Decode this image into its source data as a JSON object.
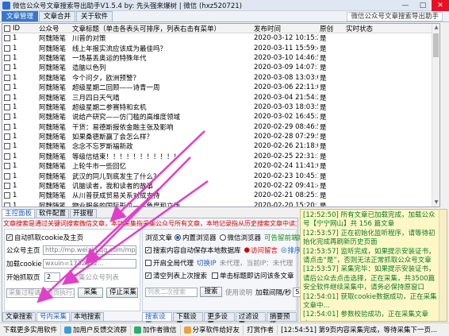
{
  "window": {
    "title": "微信公众号文章搜索导出助手V1.5.4   by:  先头强来爆树 | 微信   (hxz520721)",
    "controls": [
      "—",
      "□",
      "✕"
    ]
  },
  "top_tabs": [
    "文章管理",
    "文章合并",
    "关于软件"
  ],
  "top_right_text": "微信公众号文章搜索导出助手",
  "table": {
    "headers": [
      "ID",
      "公众号",
      "文章标题（单击各表头可排序，列表右击有菜单）",
      "发布时间",
      "原创",
      "实时状态"
    ],
    "rows": [
      {
        "id": "1",
        "account": "阿魏随笔",
        "title": "川普的对策",
        "time": "2020-03-12 10:15:24",
        "original": "是",
        "status": ""
      },
      {
        "id": "1",
        "account": "阿魏随笔",
        "title": "线上年报实流应该成为最佳吗？",
        "time": "2020-03-11 15:59:47",
        "original": "是",
        "status": ""
      },
      {
        "id": "1",
        "account": "阿魏随笔",
        "title": "一场基丢奥运的特殊年代",
        "time": "2020-03-10 14:46:52",
        "original": "是",
        "status": ""
      },
      {
        "id": "1",
        "account": "阿魏随笔",
        "title": "造脑以色列",
        "time": "2020-03-09 14:07:18",
        "original": "是",
        "status": ""
      },
      {
        "id": "1",
        "account": "阿魏随笔",
        "title": "今个问夕，欧洲预警？",
        "time": "2020-03-08 13:03:01",
        "original": "是",
        "status": ""
      },
      {
        "id": "1",
        "account": "阿魏随笔",
        "title": "超级星期二回顾——诗青一周",
        "time": "2020-03-06 22:11:07",
        "original": "是",
        "status": ""
      },
      {
        "id": "1",
        "account": "阿魏随笔",
        "title": "三月四日天气晴",
        "time": "2020-03-04 21:54:26",
        "original": "是",
        "status": ""
      },
      {
        "id": "1",
        "account": "阿魏随笔",
        "title": "超级星期二参赛特和玄机",
        "time": "2020-03-03 18:03:52",
        "original": "是",
        "status": ""
      },
      {
        "id": "1",
        "account": "阿魏随笔",
        "title": "说给产研究——仿门槛的高维度领域",
        "time": "2020-03-02 16:45:25",
        "original": "是",
        "status": ""
      },
      {
        "id": "1",
        "account": "阿魏随笔",
        "title": "干货：易德斯报依金融主张及影响",
        "time": "2020-02-29 08:46:58",
        "original": "是",
        "status": ""
      },
      {
        "id": "1",
        "account": "阿魏随笔",
        "title": "如果桑德斯赢了会怎么样？",
        "time": "2020-02-28 07:29:53",
        "original": "是",
        "status": ""
      },
      {
        "id": "1",
        "account": "阿魏随笔",
        "title": "念念不忘罗斯福新政",
        "time": "2020-02-26 21:18:09",
        "original": "是",
        "status": ""
      },
      {
        "id": "1",
        "account": "阿魏随笔",
        "title": "等级信结束！！！！！！！！！！！",
        "time": "2020-02-25 22:31:17",
        "original": "是",
        "status": ""
      },
      {
        "id": "1",
        "account": "阿魏随笔",
        "title": "上轮牛市一些回忆",
        "time": "2020-02-24 11:41:07",
        "original": "是",
        "status": ""
      },
      {
        "id": "1",
        "account": "阿魏随笔",
        "title": "武汉的同儿到底发生了什么？",
        "time": "2020-02-23 10:45:12",
        "original": "是",
        "status": ""
      },
      {
        "id": "1",
        "account": "阿魏随笔",
        "title": "讥脑读者，我和读者的故事",
        "time": "2020-02-22 09:41:43",
        "original": "是",
        "status": ""
      },
      {
        "id": "1",
        "account": "阿魏随笔",
        "title": "从川普获成贸易关系对成支持",
        "time": "2020-02-21 08:25:36",
        "original": "是",
        "status": ""
      },
      {
        "id": "1",
        "account": "阿魏随笔",
        "title": "物业服务的国际形位——角度和立场",
        "time": "2020-02-20 15:20:35",
        "original": "是",
        "status": ""
      }
    ]
  },
  "left_panel": {
    "subtabs": [
      "主控面板",
      "软件配置",
      "开拔程"
    ],
    "banner": "文章搜索是通过关键词搜索微信文章，本功采集指采集公众号所有文章，本地记录指从历史搜索文章中读文件加载",
    "auto_mode_label": "自动抓取cookie及主页",
    "account_label": "公众号主页",
    "account_value": "http://mp.weixin.qq.com/mp/pro",
    "cookie_label": "加载cookie",
    "cookie_value": "wxuin=1732052...",
    "start_page_label": "开始抓取页",
    "start_page_value": "2",
    "pending_label": "待采集公众号列表",
    "hint_text": "采集过程请到网页执行...",
    "collect_button": "采集",
    "stop_button": "停止采集",
    "bottom_tabs": [
      "文章搜索",
      "号内采集",
      "本地搜索"
    ]
  },
  "settings_panel": {
    "browse_label": "浏览文章",
    "radio_internal": "内置浏览器",
    "radio_wechat": "微信浏览器",
    "quote_text": "可告留前端期文章",
    "auto_save": "搜索内容自动保存本地数据库",
    "record_label": "访问留言",
    "sort_label": "排序",
    "proxy_label": "开启全局代理",
    "proxy_hint": "切换IP",
    "proxy_status": "未代理，当前IP：未代理",
    "clear_label": "清空列表上次搜索",
    "single_click_label": "单击标题即访问该条文章",
    "keyword_placeholder": "列表二次搜索",
    "search_button": "搜索",
    "use_rule_label": "使用说明",
    "interval_label": "加载间隔/秒",
    "interval_value": "5",
    "tabs": [
      "搜索设置",
      "下载设置",
      "更多设置",
      "过滤设置",
      "摘要预览"
    ]
  },
  "log": [
    "[12:52:50] 所有文章已加载完成，加载公众号【宁宁网山】共 156 篇文章",
    "[12:53:57] 正在初始化监听程序，请等待初始化完成再刷新历史页面",
    "[12:53:57] 监听完成，如果提示安装证书，请点击“是”，否则无法正常抓取公众号文章",
    "[12:53:57] 采集完毕：如果提示安装证书，请后公众去点击选择，正在采集，共3500篇安全软件继续采集中，请务必保持原窗口",
    "[12:54:01] 获取cookie数据成功，正在采集文章中...",
    "[12:54:01] 参数校验成功，正在采集文章中..."
  ],
  "status_bar": {
    "items": [
      "下载更多实用软件",
      "加用户反馈交流群",
      "加作者微信",
      "分享软件给好友",
      "打赏作者"
    ],
    "message": "[12:54:51] 第9页内容采集完成，等待采集下一页..."
  },
  "colors": {
    "accent": "#3a77c8",
    "log_background": "#fff8c6",
    "log_text": "#0a7a2a",
    "banner_text": "#d40000",
    "arrow": "#e040c8"
  }
}
